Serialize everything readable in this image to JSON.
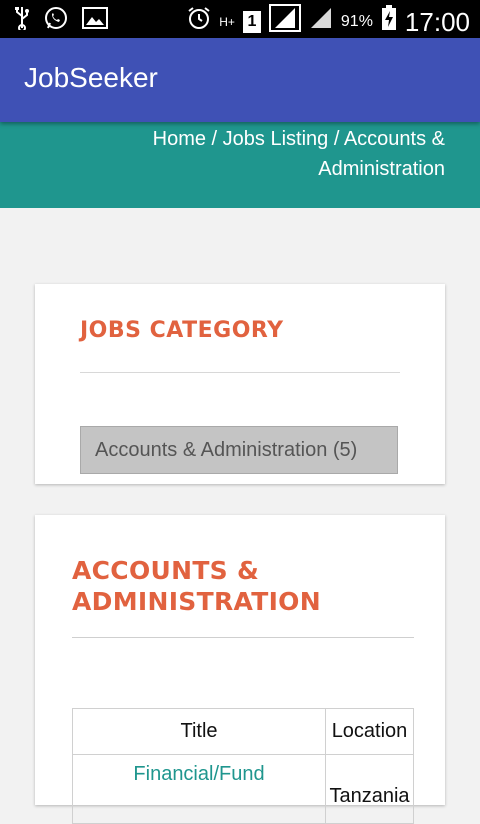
{
  "status_bar": {
    "battery_percent": "91%",
    "time": "17:00",
    "sim_label": "1",
    "network_label": "H+"
  },
  "app": {
    "title": "JobSeeker",
    "brand_color": "#3f51b5",
    "accent_color": "#1f968e"
  },
  "breadcrumb": {
    "text": "Home / Jobs Listing / Accounts & Administration"
  },
  "jobs_category": {
    "heading": "JOBS CATEGORY",
    "items": [
      {
        "label": "Accounts & Administration (5)"
      }
    ]
  },
  "category_section": {
    "heading": "ACCOUNTS & ADMINISTRATION",
    "table": {
      "columns": [
        "Title",
        "Location"
      ],
      "rows": [
        {
          "title": "Financial/Fund",
          "location": "Tanzania"
        }
      ]
    }
  },
  "icons": [
    "usb-icon",
    "whatsapp-icon",
    "gallery-icon",
    "alarm-icon",
    "signal-icon",
    "battery-charging-icon"
  ]
}
